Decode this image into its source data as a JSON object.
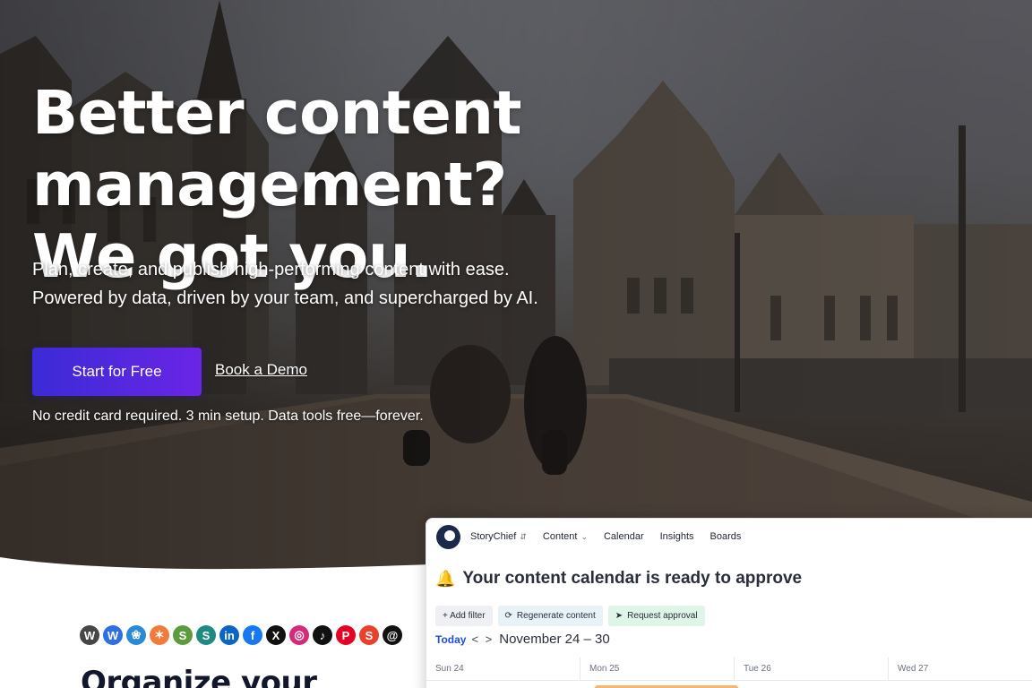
{
  "hero": {
    "headline_line1": "Better content management?",
    "headline_line2": "We got you.",
    "sub_line1": "Plan, create, and publish high-performing content with ease.",
    "sub_line2": "Powered by data, driven by your team, and supercharged by AI.",
    "primary_cta": "Start for Free",
    "secondary_cta": "Book a Demo",
    "note": "No credit card required. 3 min setup. Data tools free—forever."
  },
  "integrations": {
    "logos": [
      {
        "name": "wordpress-icon",
        "glyph": "W",
        "color": "#464646"
      },
      {
        "name": "webflow-icon",
        "glyph": "W",
        "color": "#2f6fe4"
      },
      {
        "name": "drupal-icon",
        "glyph": "❀",
        "color": "#2b8ad6"
      },
      {
        "name": "hubspot-icon",
        "glyph": "✶",
        "color": "#f07b3a"
      },
      {
        "name": "shopify-icon",
        "glyph": "S",
        "color": "#5e9b3d"
      },
      {
        "name": "sharepoint-icon",
        "glyph": "S",
        "color": "#1f8a83"
      },
      {
        "name": "linkedin-icon",
        "glyph": "in",
        "color": "#0a66c2"
      },
      {
        "name": "facebook-icon",
        "glyph": "f",
        "color": "#1877f2"
      },
      {
        "name": "x-icon",
        "glyph": "X",
        "color": "#111111"
      },
      {
        "name": "instagram-icon",
        "glyph": "◎",
        "color": "#d6297a"
      },
      {
        "name": "tiktok-icon",
        "glyph": "♪",
        "color": "#111111"
      },
      {
        "name": "pinterest-icon",
        "glyph": "P",
        "color": "#e60023"
      },
      {
        "name": "buffer-icon",
        "glyph": "S",
        "color": "#e8412c"
      },
      {
        "name": "threads-icon",
        "glyph": "@",
        "color": "#111111"
      }
    ]
  },
  "section": {
    "title": "Organize your"
  },
  "app": {
    "workspace": "StoryChief",
    "nav": [
      "Content",
      "Calendar",
      "Insights",
      "Boards"
    ],
    "title": "Your content calendar is ready to approve",
    "chips": [
      "+ Add filter",
      "Regenerate content",
      "Request approval"
    ],
    "today": "Today",
    "arrows": "< >",
    "range": "November 24 – 30",
    "days": [
      "Sun 24",
      "Mon 25",
      "Tue 26",
      "Wed 27"
    ]
  }
}
